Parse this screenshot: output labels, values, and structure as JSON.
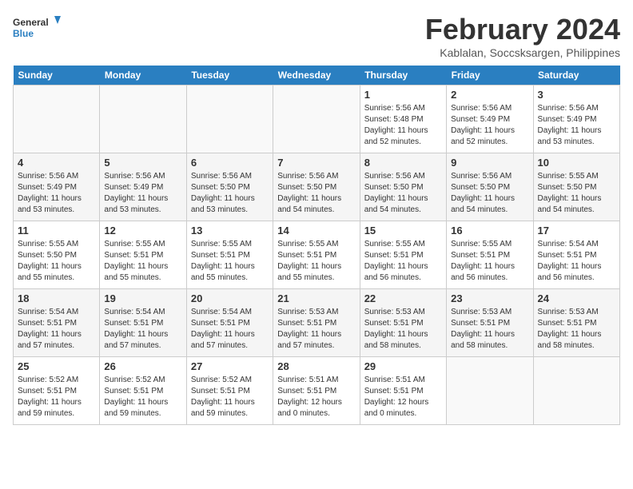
{
  "logo": {
    "line1": "General",
    "line2": "Blue"
  },
  "calendar": {
    "title": "February 2024",
    "subtitle": "Kablalan, Soccsksargen, Philippines"
  },
  "headers": [
    "Sunday",
    "Monday",
    "Tuesday",
    "Wednesday",
    "Thursday",
    "Friday",
    "Saturday"
  ],
  "weeks": [
    [
      {
        "day": "",
        "info": ""
      },
      {
        "day": "",
        "info": ""
      },
      {
        "day": "",
        "info": ""
      },
      {
        "day": "",
        "info": ""
      },
      {
        "day": "1",
        "info": "Sunrise: 5:56 AM\nSunset: 5:48 PM\nDaylight: 11 hours\nand 52 minutes."
      },
      {
        "day": "2",
        "info": "Sunrise: 5:56 AM\nSunset: 5:49 PM\nDaylight: 11 hours\nand 52 minutes."
      },
      {
        "day": "3",
        "info": "Sunrise: 5:56 AM\nSunset: 5:49 PM\nDaylight: 11 hours\nand 53 minutes."
      }
    ],
    [
      {
        "day": "4",
        "info": "Sunrise: 5:56 AM\nSunset: 5:49 PM\nDaylight: 11 hours\nand 53 minutes."
      },
      {
        "day": "5",
        "info": "Sunrise: 5:56 AM\nSunset: 5:49 PM\nDaylight: 11 hours\nand 53 minutes."
      },
      {
        "day": "6",
        "info": "Sunrise: 5:56 AM\nSunset: 5:50 PM\nDaylight: 11 hours\nand 53 minutes."
      },
      {
        "day": "7",
        "info": "Sunrise: 5:56 AM\nSunset: 5:50 PM\nDaylight: 11 hours\nand 54 minutes."
      },
      {
        "day": "8",
        "info": "Sunrise: 5:56 AM\nSunset: 5:50 PM\nDaylight: 11 hours\nand 54 minutes."
      },
      {
        "day": "9",
        "info": "Sunrise: 5:56 AM\nSunset: 5:50 PM\nDaylight: 11 hours\nand 54 minutes."
      },
      {
        "day": "10",
        "info": "Sunrise: 5:55 AM\nSunset: 5:50 PM\nDaylight: 11 hours\nand 54 minutes."
      }
    ],
    [
      {
        "day": "11",
        "info": "Sunrise: 5:55 AM\nSunset: 5:50 PM\nDaylight: 11 hours\nand 55 minutes."
      },
      {
        "day": "12",
        "info": "Sunrise: 5:55 AM\nSunset: 5:51 PM\nDaylight: 11 hours\nand 55 minutes."
      },
      {
        "day": "13",
        "info": "Sunrise: 5:55 AM\nSunset: 5:51 PM\nDaylight: 11 hours\nand 55 minutes."
      },
      {
        "day": "14",
        "info": "Sunrise: 5:55 AM\nSunset: 5:51 PM\nDaylight: 11 hours\nand 55 minutes."
      },
      {
        "day": "15",
        "info": "Sunrise: 5:55 AM\nSunset: 5:51 PM\nDaylight: 11 hours\nand 56 minutes."
      },
      {
        "day": "16",
        "info": "Sunrise: 5:55 AM\nSunset: 5:51 PM\nDaylight: 11 hours\nand 56 minutes."
      },
      {
        "day": "17",
        "info": "Sunrise: 5:54 AM\nSunset: 5:51 PM\nDaylight: 11 hours\nand 56 minutes."
      }
    ],
    [
      {
        "day": "18",
        "info": "Sunrise: 5:54 AM\nSunset: 5:51 PM\nDaylight: 11 hours\nand 57 minutes."
      },
      {
        "day": "19",
        "info": "Sunrise: 5:54 AM\nSunset: 5:51 PM\nDaylight: 11 hours\nand 57 minutes."
      },
      {
        "day": "20",
        "info": "Sunrise: 5:54 AM\nSunset: 5:51 PM\nDaylight: 11 hours\nand 57 minutes."
      },
      {
        "day": "21",
        "info": "Sunrise: 5:53 AM\nSunset: 5:51 PM\nDaylight: 11 hours\nand 57 minutes."
      },
      {
        "day": "22",
        "info": "Sunrise: 5:53 AM\nSunset: 5:51 PM\nDaylight: 11 hours\nand 58 minutes."
      },
      {
        "day": "23",
        "info": "Sunrise: 5:53 AM\nSunset: 5:51 PM\nDaylight: 11 hours\nand 58 minutes."
      },
      {
        "day": "24",
        "info": "Sunrise: 5:53 AM\nSunset: 5:51 PM\nDaylight: 11 hours\nand 58 minutes."
      }
    ],
    [
      {
        "day": "25",
        "info": "Sunrise: 5:52 AM\nSunset: 5:51 PM\nDaylight: 11 hours\nand 59 minutes."
      },
      {
        "day": "26",
        "info": "Sunrise: 5:52 AM\nSunset: 5:51 PM\nDaylight: 11 hours\nand 59 minutes."
      },
      {
        "day": "27",
        "info": "Sunrise: 5:52 AM\nSunset: 5:51 PM\nDaylight: 11 hours\nand 59 minutes."
      },
      {
        "day": "28",
        "info": "Sunrise: 5:51 AM\nSunset: 5:51 PM\nDaylight: 12 hours\nand 0 minutes."
      },
      {
        "day": "29",
        "info": "Sunrise: 5:51 AM\nSunset: 5:51 PM\nDaylight: 12 hours\nand 0 minutes."
      },
      {
        "day": "",
        "info": ""
      },
      {
        "day": "",
        "info": ""
      }
    ]
  ]
}
